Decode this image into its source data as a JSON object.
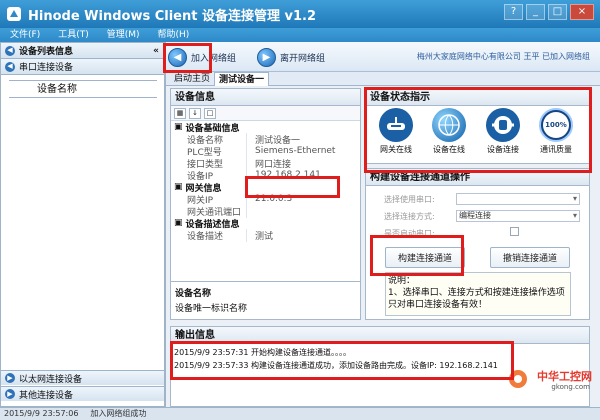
{
  "titlebar": {
    "title": "Hinode Windows Client 设备连接管理 v1.2",
    "controls": [
      "?",
      "_",
      "□",
      "×"
    ]
  },
  "menu": [
    "文件(F)",
    "工具(T)",
    "管理(M)",
    "帮助(H)"
  ],
  "left": {
    "device_list_title": "设备列表信息",
    "serial_section": "串口连接设备",
    "column_header": "设备名称",
    "ethernet_section": "以太网连接设备",
    "other_section": "其他连接设备"
  },
  "toolbar": {
    "join_button": "加入网络组",
    "leave_button": "离开网络组",
    "right_link": "梅州大家庭网络中心有限公司 王平 已加入网络组"
  },
  "tabs": {
    "home": "启动主页",
    "active": "测试设备一"
  },
  "device_info": {
    "title": "设备信息",
    "group1": "设备基础信息",
    "rows1": [
      {
        "k": "设备名称",
        "v": "测试设备一"
      },
      {
        "k": "PLC型号",
        "v": "Siemens-Ethernet"
      },
      {
        "k": "接口类型",
        "v": "网口连接"
      },
      {
        "k": "设备IP",
        "v": "192.168.2.141"
      }
    ],
    "group2": "网关信息",
    "rows2": [
      {
        "k": "网关IP",
        "v": "21.0.0.3"
      },
      {
        "k": "网关通讯端口",
        "v": ""
      }
    ],
    "group3": "设备描述信息",
    "rows3": [
      {
        "k": "设备描述",
        "v": "测试"
      }
    ],
    "bottom_title": "设备名称",
    "bottom_desc": "设备唯一标识名称"
  },
  "state": {
    "title": "设备状态指示",
    "items": [
      {
        "label": "网关在线",
        "icon": "gateway-online-icon"
      },
      {
        "label": "设备在线",
        "icon": "globe-device-online-icon"
      },
      {
        "label": "设备连接",
        "icon": "plug-connection-icon"
      },
      {
        "label": "通讯质量",
        "icon": "quality-meter-icon",
        "value": "100%"
      }
    ]
  },
  "control": {
    "title": "构建设备连接通道操作",
    "serial_label": "选择使用串口:",
    "serial_value": "",
    "mode_label": "选择连接方式:",
    "mode_value": "编程连接",
    "enable_label": "是否启动串口:",
    "build_button": "构建连接通道",
    "cancel_button": "撤销连接通道",
    "note": "说明：\n1、选择串口、连接方式和按建连接操作选项只对串口连接设备有效！"
  },
  "output": {
    "title": "输出信息",
    "lines": [
      "2015/9/9 23:57:31 开始构建设备连接通道。。。。",
      "2015/9/9 23:57:33 构建设备连接通道成功，添加设备路由完成。设备IP: 192.168.2.141"
    ]
  },
  "status": {
    "time": "2015/9/9 23:57:06",
    "message": "加入网络组成功"
  },
  "watermark": {
    "brand": "中华工控网",
    "site": "gkong.com"
  },
  "colors": {
    "title_blue": "#2d89c8",
    "highlight": "#e01d1d",
    "panel_bg": "#eaf0f6"
  }
}
